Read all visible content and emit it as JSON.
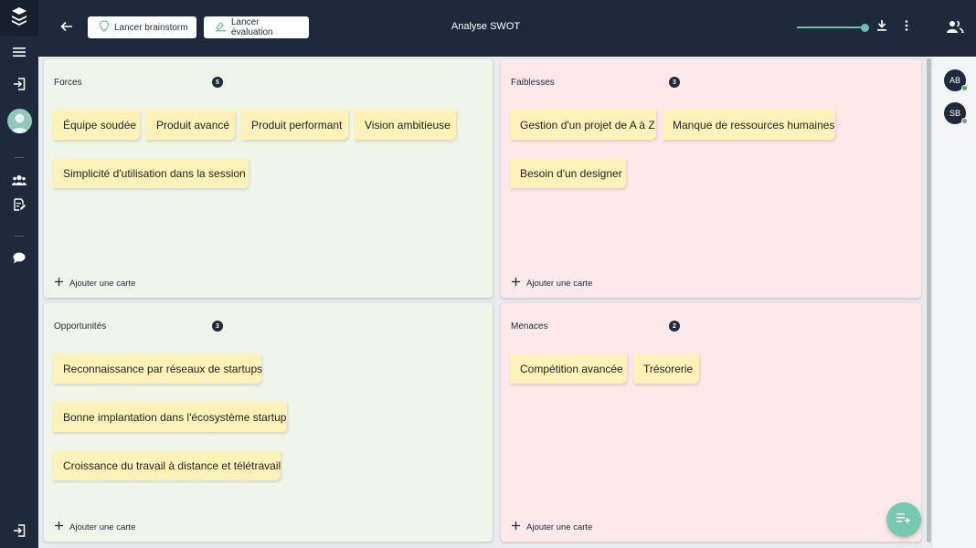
{
  "header": {
    "title": "Analyse SWOT",
    "brainstorm_label": "Lancer brainstorm",
    "evaluation_label": "Lancer évaluation"
  },
  "icons": {
    "logo": "stack-logo-icon",
    "menu": "hamburger-menu-icon",
    "enter": "login-icon",
    "team": "group-icon",
    "edit": "edit-document-icon",
    "chat": "chat-bubble-icon",
    "logout": "logout-icon",
    "back": "arrow-left-icon",
    "bulb": "lightbulb-icon",
    "evaluate": "evaluation-icon",
    "download": "download-icon",
    "more": "more-vertical-icon",
    "participants": "participants-icon",
    "fab": "add-list-icon"
  },
  "colors": {
    "navy": "#1e2a3b",
    "accent": "#66c2a8",
    "strengths_bg": "#eff5e8",
    "weaknesses_bg": "#fde8ea",
    "card_bg": "#fdf3b8",
    "online": "#4caf50",
    "offline": "#8a8f98"
  },
  "participants": [
    {
      "initials": "AB",
      "status": "online"
    },
    {
      "initials": "SB",
      "status": "offline"
    }
  ],
  "add_card_label": "Ajouter une carte",
  "quadrants": {
    "forces": {
      "title": "Forces",
      "count": "5",
      "cards": [
        "Équipe soudée",
        "Produit avancé",
        "Produit performant",
        "Vision ambitieuse",
        "Simplicité d'utilisation dans la session"
      ]
    },
    "faiblesses": {
      "title": "Faiblesses",
      "count": "3",
      "cards": [
        "Gestion d'un projet de A à Z",
        "Manque de ressources humaines",
        "Besoin d'un designer"
      ]
    },
    "opportunites": {
      "title": "Opportunités",
      "count": "3",
      "cards": [
        "Reconnaissance par réseaux de startups",
        "Bonne implantation dans l'écosystème startup",
        "Croissance du travail à distance et télétravail"
      ]
    },
    "menaces": {
      "title": "Menaces",
      "count": "2",
      "cards": [
        "Compétition avancée",
        "Trésorerie"
      ]
    }
  }
}
